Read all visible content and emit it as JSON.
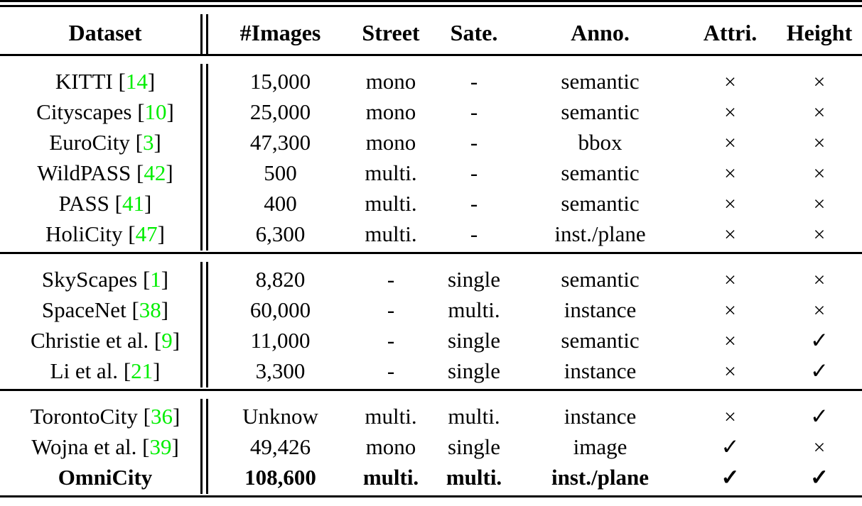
{
  "table": {
    "columns": [
      {
        "key": "dataset",
        "label": "Dataset"
      },
      {
        "key": "images",
        "label": "#Images"
      },
      {
        "key": "street",
        "label": "Street"
      },
      {
        "key": "sate",
        "label": "Sate."
      },
      {
        "key": "anno",
        "label": "Anno."
      },
      {
        "key": "attri",
        "label": "Attri."
      },
      {
        "key": "height",
        "label": "Height"
      }
    ],
    "cite_color": "#00ee00",
    "symbols": {
      "cross": "×",
      "check": "✓",
      "dash": "-"
    },
    "blocks": [
      {
        "rows": [
          {
            "name": "KITTI",
            "cite": "14",
            "images": "15,000",
            "street": "mono",
            "sate": "-",
            "anno": "semantic",
            "attri": "×",
            "height": "×"
          },
          {
            "name": "Cityscapes",
            "cite": "10",
            "images": "25,000",
            "street": "mono",
            "sate": "-",
            "anno": "semantic",
            "attri": "×",
            "height": "×"
          },
          {
            "name": "EuroCity",
            "cite": "3",
            "images": "47,300",
            "street": "mono",
            "sate": "-",
            "anno": "bbox",
            "attri": "×",
            "height": "×"
          },
          {
            "name": "WildPASS",
            "cite": "42",
            "images": "500",
            "street": "multi.",
            "sate": "-",
            "anno": "semantic",
            "attri": "×",
            "height": "×"
          },
          {
            "name": "PASS",
            "cite": "41",
            "images": "400",
            "street": "multi.",
            "sate": "-",
            "anno": "semantic",
            "attri": "×",
            "height": "×"
          },
          {
            "name": "HoliCity",
            "cite": "47",
            "images": "6,300",
            "street": "multi.",
            "sate": "-",
            "anno": "inst./plane",
            "attri": "×",
            "height": "×"
          }
        ]
      },
      {
        "rows": [
          {
            "name": "SkyScapes",
            "cite": "1",
            "images": "8,820",
            "street": "-",
            "sate": "single",
            "anno": "semantic",
            "attri": "×",
            "height": "×"
          },
          {
            "name": "SpaceNet",
            "cite": "38",
            "images": "60,000",
            "street": "-",
            "sate": "multi.",
            "anno": "instance",
            "attri": "×",
            "height": "×"
          },
          {
            "name": "Christie et al.",
            "cite": "9",
            "images": "11,000",
            "street": "-",
            "sate": "single",
            "anno": "semantic",
            "attri": "×",
            "height": "✓"
          },
          {
            "name": "Li et al.",
            "cite": "21",
            "images": "3,300",
            "street": "-",
            "sate": "single",
            "anno": "instance",
            "attri": "×",
            "height": "✓"
          }
        ]
      },
      {
        "rows": [
          {
            "name": "TorontoCity",
            "cite": "36",
            "images": "Unknow",
            "street": "multi.",
            "sate": "multi.",
            "anno": "instance",
            "attri": "×",
            "height": "✓"
          },
          {
            "name": "Wojna et al.",
            "cite": "39",
            "images": "49,426",
            "street": "mono",
            "sate": "single",
            "anno": "image",
            "attri": "✓",
            "height": "×"
          },
          {
            "name": "OmniCity",
            "cite": null,
            "images": "108,600",
            "street": "multi.",
            "sate": "multi.",
            "anno": "inst./plane",
            "attri": "✓",
            "height": "✓",
            "bold": true
          }
        ]
      }
    ]
  }
}
